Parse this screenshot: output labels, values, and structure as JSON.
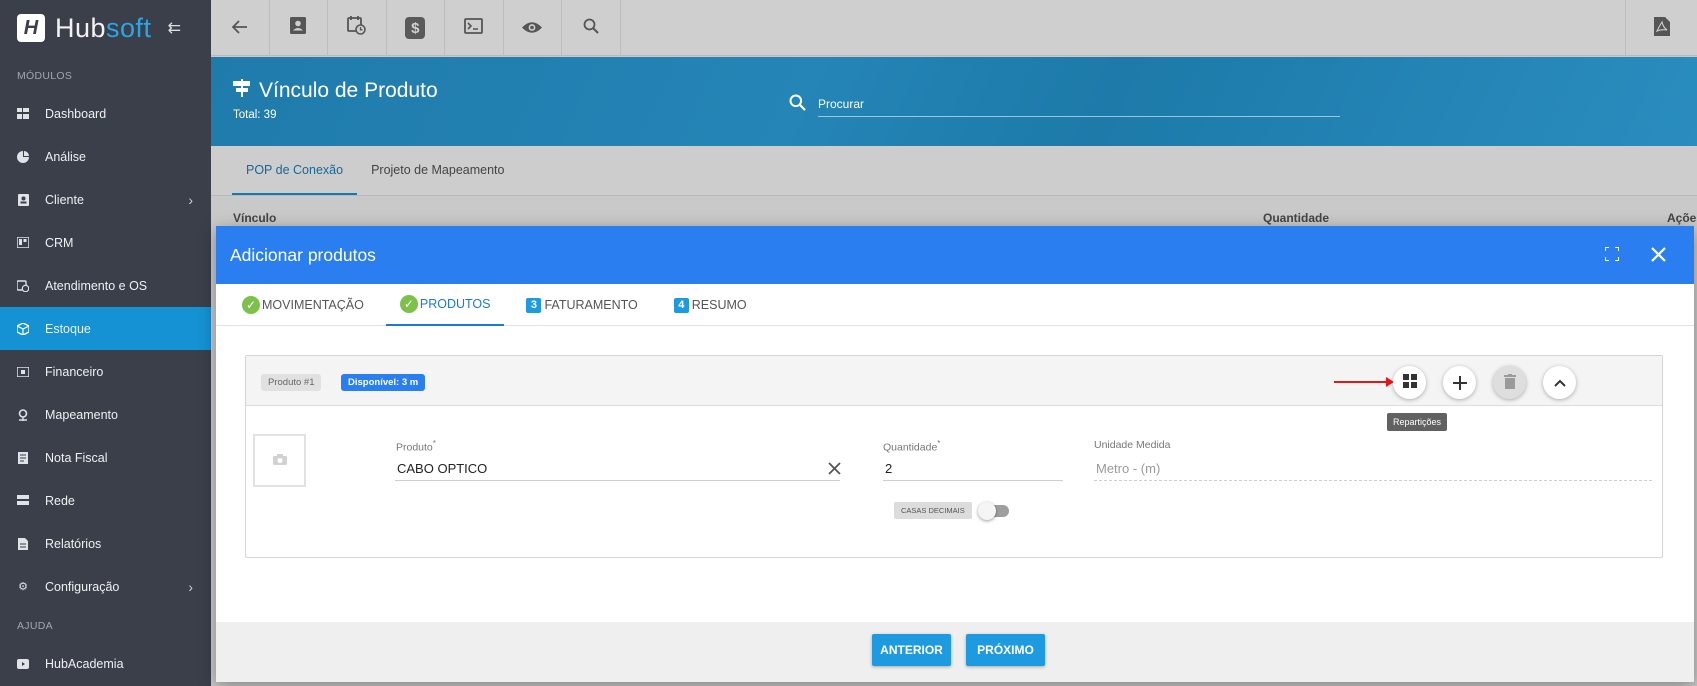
{
  "brand": {
    "logo_letter": "H",
    "name_part1": "Hub",
    "name_part2": "soft",
    "collapse_icon": "collapse-icon"
  },
  "sidebar": {
    "section_modules": "MÓDULOS",
    "items": [
      {
        "label": "Dashboard",
        "icon": "dashboard-icon"
      },
      {
        "label": "Análise",
        "icon": "pie-chart-icon"
      },
      {
        "label": "Cliente",
        "icon": "contact-card-icon",
        "has_submenu": true
      },
      {
        "label": "CRM",
        "icon": "board-icon"
      },
      {
        "label": "Atendimento e OS",
        "icon": "calendar-clock-icon"
      },
      {
        "label": "Estoque",
        "icon": "cube-icon",
        "active": true
      },
      {
        "label": "Financeiro",
        "icon": "money-icon"
      },
      {
        "label": "Mapeamento",
        "icon": "map-pin-icon"
      },
      {
        "label": "Nota Fiscal",
        "icon": "document-icon"
      },
      {
        "label": "Rede",
        "icon": "server-icon"
      },
      {
        "label": "Relatórios",
        "icon": "report-icon"
      },
      {
        "label": "Configuração",
        "icon": "gear-icon",
        "has_submenu": true
      }
    ],
    "section_help": "AJUDA",
    "help_items": [
      {
        "label": "HubAcademia",
        "icon": "play-icon"
      }
    ]
  },
  "toolbar": {
    "buttons": [
      "back-arrow-icon",
      "contact-card-icon",
      "calendar-clock-icon",
      "dollar-icon",
      "terminal-icon",
      "eye-icon",
      "search-icon"
    ],
    "dollar_symbol": "$",
    "right_button": "pdf-icon"
  },
  "header": {
    "title": "Vínculo de Produto",
    "total": "Total: 39",
    "search_placeholder": "Procurar"
  },
  "page_tabs": [
    {
      "label": "POP de Conexão",
      "active": true
    },
    {
      "label": "Projeto de Mapeamento",
      "active": false
    }
  ],
  "list_columns": {
    "col1": "Vínculo",
    "col2": "Quantidade",
    "col3": "Ações"
  },
  "modal": {
    "title": "Adicionar produtos",
    "steps": [
      {
        "label": "MOVIMENTAÇÃO",
        "status": "done"
      },
      {
        "label": "PRODUTOS",
        "status": "done",
        "active": true
      },
      {
        "label": "FATURAMENTO",
        "number": "3"
      },
      {
        "label": "RESUMO",
        "number": "4"
      }
    ],
    "product_card": {
      "chip_product": "Produto #1",
      "chip_available": "Disponível: 3 m",
      "tooltip": "Repartições",
      "fields": {
        "produto_label": "Produto",
        "produto_value": "CABO OPTICO",
        "quantidade_label": "Quantidade",
        "quantidade_value": "2",
        "unidade_label": "Unidade Medida",
        "unidade_value": "Metro - (m)"
      },
      "casas_decimais_label": "CASAS DECIMAIS",
      "casas_decimais_on": false
    },
    "buttons": {
      "prev": "ANTERIOR",
      "next": "PRÓXIMO"
    }
  },
  "colors": {
    "accent_blue": "#2a7ef0",
    "active_nav": "#1592d3",
    "sidebar_bg": "#3a3f4a",
    "success": "#7cc24a",
    "arrow_red": "#e21818"
  }
}
